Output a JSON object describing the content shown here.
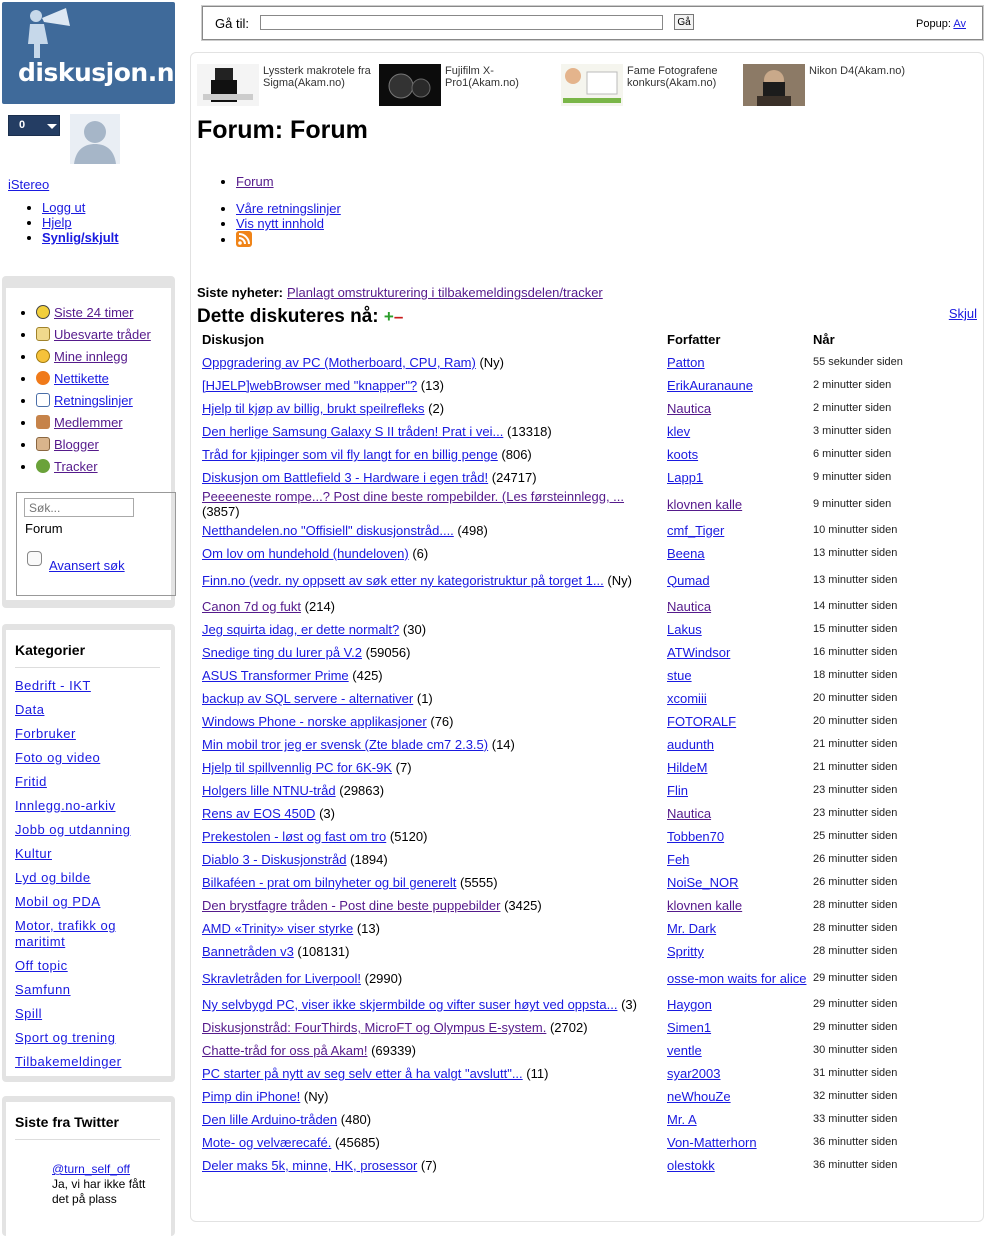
{
  "site": {
    "logo_text": "diskusjon.no"
  },
  "user": {
    "notification_count": "0",
    "name": "iStereo",
    "links": [
      "Logg ut",
      "Hjelp",
      "Synlig/skjult"
    ]
  },
  "nav": {
    "items": [
      {
        "label": "Siste 24 timer",
        "icon": "clock-icon"
      },
      {
        "label": "Ubesvarte tråder",
        "icon": "envelope-icon"
      },
      {
        "label": "Mine innlegg",
        "icon": "smiley-icon"
      },
      {
        "label": "Nettikette",
        "icon": "alert-icon"
      },
      {
        "label": "Retningslinjer",
        "icon": "document-icon"
      },
      {
        "label": "Medlemmer",
        "icon": "people-icon"
      },
      {
        "label": "Blogger",
        "icon": "blog-icon"
      },
      {
        "label": "Tracker",
        "icon": "bug-icon"
      }
    ],
    "search_placeholder": "Søk...",
    "search_scope": "Forum",
    "advanced_search": "Avansert søk"
  },
  "categories": {
    "title": "Kategorier",
    "items": [
      "Bedrift - IKT",
      "Data",
      "Forbruker",
      "Foto og video",
      "Fritid",
      "Innlegg.no-arkiv",
      "Jobb og utdanning",
      "Kultur",
      "Lyd og bilde",
      "Mobil og PDA",
      "Motor, trafikk og maritimt",
      "Off topic",
      "Samfunn",
      "Spill",
      "Sport og trening",
      "Tilbakemeldinger"
    ]
  },
  "twitter": {
    "title": "Siste fra Twitter",
    "handle": "@turn_self_off",
    "text": "Ja, vi har ikke fått det på plass"
  },
  "gobar": {
    "label": "Gå til:",
    "button": "Gå",
    "popup_label": "Popup:",
    "popup_link": "Av"
  },
  "promos": [
    {
      "title": "Lyssterk makrotele fra Sigma(Akam.no)"
    },
    {
      "title": "Fujifilm X-Pro1(Akam.no)"
    },
    {
      "title": "Fame Fotografene konkurs(Akam.no)"
    },
    {
      "title": "Nikon D4(Akam.no)"
    }
  ],
  "forum": {
    "title": "Forum: Forum",
    "breadcrumb": "Forum",
    "links": [
      "Våre retningslinjer",
      "Vis nytt innhold"
    ],
    "news_label": "Siste nyheter:",
    "news_link": "Planlagt omstrukturering i tilbakemeldingsdelen/tracker",
    "now_title": "Dette diskuteres nå:",
    "hide": "Skjul",
    "columns": [
      "Diskusjon",
      "Forfatter",
      "Når"
    ],
    "threads": [
      {
        "title": "Oppgradering av PC (Motherboard, CPU, Ram)",
        "count": "(Ny)",
        "author": "Patton",
        "when": "55 sekunder siden"
      },
      {
        "title": "[HJELP]webBrowser med \"knapper\"?",
        "count": "(13)",
        "author": "ErikAuranaune",
        "when": "2 minutter siden"
      },
      {
        "title": "Hjelp til kjøp av billig, brukt speilrefleks",
        "count": "(2)",
        "author": "Nautica",
        "when": "2 minutter siden",
        "visited_author": true
      },
      {
        "title": "Den herlige Samsung Galaxy S II tråden! Prat i vei...",
        "count": "(13318)",
        "author": "klev",
        "when": "3 minutter siden"
      },
      {
        "title": "Tråd for kjipinger som vil fly langt for en billig penge",
        "count": "(806)",
        "author": "koots",
        "when": "6 minutter siden"
      },
      {
        "title": "Diskusjon om Battlefield 3 - Hardware i egen tråd!",
        "count": "(24717)",
        "author": "Lapp1",
        "when": "9 minutter siden"
      },
      {
        "title": "Peeeeneste rompe...? Post dine beste rompebilder. (Les førsteinnlegg, ...",
        "count": "(3857)",
        "author": "klovnen kalle",
        "when": "9 minutter siden",
        "visited": true,
        "visited_author": true
      },
      {
        "title": "Netthandelen.no \"Offisiell\" diskusjonstråd....",
        "count": "(498)",
        "author": "cmf_Tiger",
        "when": "10 minutter siden"
      },
      {
        "title": "Om lov om hundehold (hundeloven)",
        "count": "(6)",
        "author": "Beena",
        "when": "13 minutter siden"
      },
      {
        "title": "Finn.no (vedr. ny oppsett av søk etter ny kategoristruktur på torget 1...",
        "count": "(Ny)",
        "author": "Qumad",
        "when": "13 minutter siden"
      },
      {
        "title": "Canon 7d og fukt",
        "count": "(214)",
        "author": "Nautica",
        "when": "14 minutter siden",
        "visited": true,
        "visited_author": true
      },
      {
        "title": "Jeg squirta idag, er dette normalt?",
        "count": "(30)",
        "author": "Lakus",
        "when": "15 minutter siden"
      },
      {
        "title": "Snedige ting du lurer på V.2",
        "count": "(59056)",
        "author": "ATWindsor",
        "when": "16 minutter siden"
      },
      {
        "title": "ASUS Transformer Prime",
        "count": "(425)",
        "author": "stue",
        "when": "18 minutter siden"
      },
      {
        "title": "backup av SQL servere - alternativer",
        "count": "(1)",
        "author": "xcomiii",
        "when": "20 minutter siden"
      },
      {
        "title": "Windows Phone - norske applikasjoner",
        "count": "(76)",
        "author": "FOTORALF",
        "when": "20 minutter siden"
      },
      {
        "title": "Min mobil tror jeg er svensk (Zte blade cm7 2.3.5)",
        "count": "(14)",
        "author": "audunth",
        "when": "21 minutter siden"
      },
      {
        "title": "Hjelp til spillvennlig PC for 6K-9K",
        "count": "(7)",
        "author": "HildeM",
        "when": "21 minutter siden"
      },
      {
        "title": "Holgers lille NTNU-tråd",
        "count": "(29863)",
        "author": "Flin",
        "when": "23 minutter siden"
      },
      {
        "title": "Rens av EOS 450D",
        "count": "(3)",
        "author": "Nautica",
        "when": "23 minutter siden",
        "visited_author": true
      },
      {
        "title": "Prekestolen - løst og fast om tro",
        "count": "(5120)",
        "author": "Tobben70",
        "when": "25 minutter siden"
      },
      {
        "title": "Diablo 3 - Diskusjonstråd",
        "count": "(1894)",
        "author": "Feh",
        "when": "26 minutter siden"
      },
      {
        "title": "Bilkaféen - prat om bilnyheter og bil generelt",
        "count": "(5555)",
        "author": "NoiSe_NOR",
        "when": "26 minutter siden"
      },
      {
        "title": "Den brystfagre tråden - Post dine beste puppebilder",
        "count": "(3425)",
        "author": "klovnen kalle",
        "when": "28 minutter siden",
        "visited": true,
        "visited_author": true
      },
      {
        "title": "AMD «Trinity» viser styrke",
        "count": "(13)",
        "author": "Mr. Dark",
        "when": "28 minutter siden"
      },
      {
        "title": "Bannetråden v3",
        "count": "(108131)",
        "author": "Spritty",
        "when": "28 minutter siden"
      },
      {
        "title": "Skravletråden for Liverpool!",
        "count": "(2990)",
        "author": "osse-mon waits for alice",
        "when": "29 minutter siden"
      },
      {
        "title": "Ny selvbygd PC, viser ikke skjermbilde og vifter suser høyt ved oppsta...",
        "count": "(3)",
        "author": "Haygon",
        "when": "29 minutter siden"
      },
      {
        "title": "Diskusjonstråd: FourThirds, MicroFT og Olympus E-system.",
        "count": "(2702)",
        "author": "Simen1",
        "when": "29 minutter siden",
        "visited": true
      },
      {
        "title": "Chatte-tråd for oss på Akam!",
        "count": "(69339)",
        "author": "ventle",
        "when": "30 minutter siden",
        "visited": true
      },
      {
        "title": "PC starter på nytt av seg selv etter å ha valgt \"avslutt\"...",
        "count": "(11)",
        "author": "syar2003",
        "when": "31 minutter siden"
      },
      {
        "title": "Pimp din iPhone!",
        "count": "(Ny)",
        "author": "neWhouZe",
        "when": "32 minutter siden"
      },
      {
        "title": "Den lille Arduino-tråden",
        "count": "(480)",
        "author": "Mr. A",
        "when": "33 minutter siden"
      },
      {
        "title": "Mote- og velværecafé.",
        "count": "(45685)",
        "author": "Von-Matterhorn",
        "when": "36 minutter siden"
      },
      {
        "title": "Deler maks 5k, minne, HK, prosessor",
        "count": "(7)",
        "author": "olestokk",
        "when": "36 minutter siden"
      }
    ]
  }
}
